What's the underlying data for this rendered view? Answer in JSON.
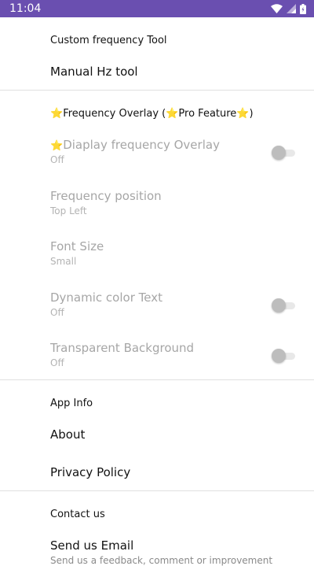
{
  "status": {
    "time": "11:04"
  },
  "sections": {
    "custom": {
      "header": "Custom frequency Tool",
      "manual_title": "Manual Hz tool"
    },
    "overlay": {
      "header_star_left": "⭐",
      "header_text": "Frequency Overlay (",
      "header_star_mid": "⭐",
      "header_text2": "Pro Feature",
      "header_star_right": "⭐",
      "header_close": ")",
      "display": {
        "star": "⭐",
        "title": "Diaplay frequency Overlay",
        "summary": "Off",
        "checked": false
      },
      "position": {
        "title": "Frequency position",
        "summary": "Top Left"
      },
      "font_size": {
        "title": "Font Size",
        "summary": "Small"
      },
      "dynamic_color": {
        "title": "Dynamic color Text",
        "summary": "Off",
        "checked": false
      },
      "transparent_bg": {
        "title": "Transparent Background",
        "summary": "Off",
        "checked": false
      }
    },
    "app_info": {
      "header": "App Info",
      "about": "About",
      "privacy": "Privacy Policy"
    },
    "contact": {
      "header": "Contact us",
      "email_title": "Send us Email",
      "email_summary": "Send us a feedback, comment or improvement"
    }
  },
  "colors": {
    "status_bar": "#6a4fb0",
    "divider": "#e0e0e0"
  }
}
